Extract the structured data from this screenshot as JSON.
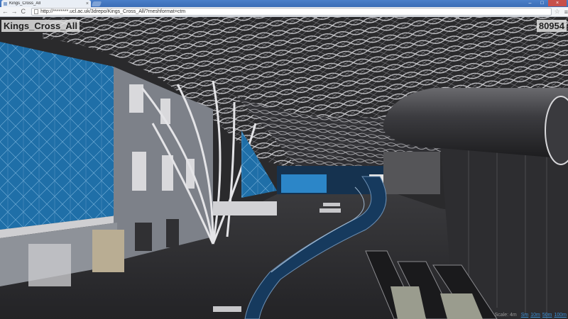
{
  "browser": {
    "tab_title": "Kings_Cross_All",
    "tab_close": "×",
    "url": "http://********.ucl.ac.uk/3drepo/Kings_Cross_All/?meshformat=ctm",
    "window_controls": {
      "minimize": "–",
      "maximize": "□",
      "close": "×"
    },
    "nav": {
      "back": "←",
      "forward": "→",
      "reload": "C"
    },
    "star": "☆",
    "menu": "≡"
  },
  "viewer": {
    "model_name": "Kings_Cross_All",
    "fps": "80954",
    "scale": {
      "label": "Scale: 4m",
      "options": [
        "Sm",
        "10m",
        "50m",
        "100m"
      ]
    }
  },
  "colors": {
    "facade_blue": "#1f6fa8",
    "stone_grey": "#7d8189",
    "floor": "#2b2b2e",
    "roof_line": "#d8d8d8",
    "link_blue": "#3a8fd4"
  }
}
